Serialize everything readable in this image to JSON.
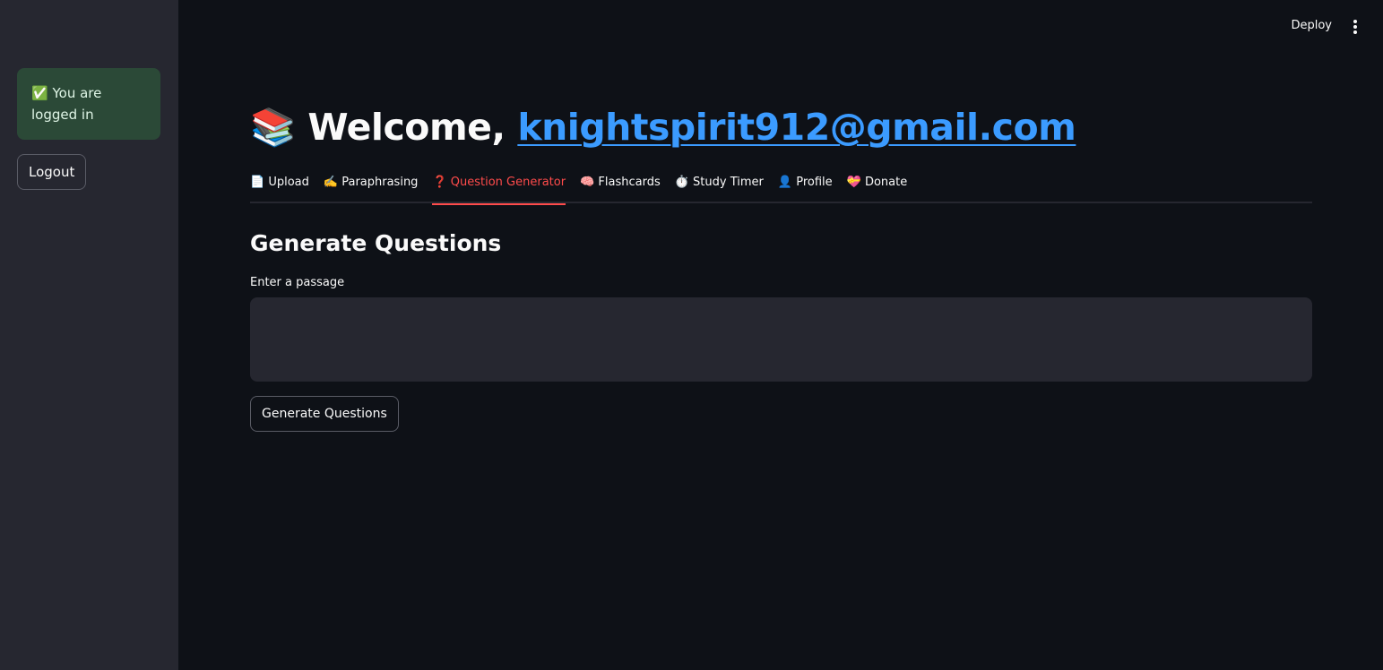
{
  "sidebar": {
    "alert_icon": "✅",
    "alert_text": "You are logged in",
    "logout_label": "Logout"
  },
  "header": {
    "deploy_label": "Deploy",
    "menu_icon": "kebab-menu-icon"
  },
  "main": {
    "title_icon": "📚",
    "title_prefix": "Welcome,",
    "title_email": "knightspirit912@gmail.com",
    "tabs": [
      {
        "icon": "📄",
        "label": "Upload"
      },
      {
        "icon": "✍️",
        "label": "Paraphrasing"
      },
      {
        "icon": "❓",
        "label": "Question Generator"
      },
      {
        "icon": "🧠",
        "label": "Flashcards"
      },
      {
        "icon": "⏱️",
        "label": "Study Timer"
      },
      {
        "icon": "👤",
        "label": "Profile"
      },
      {
        "icon": "💝",
        "label": "Donate"
      }
    ],
    "active_tab": "Question Generator",
    "section_title": "Generate Questions",
    "passage_label": "Enter a passage",
    "passage_value": "",
    "generate_button_label": "Generate Questions"
  },
  "colors": {
    "background": "#0e1117",
    "sidebar": "#262730",
    "accent": "#ff4b4b",
    "link": "#3b9bff",
    "success_bg": "#2b4937"
  }
}
